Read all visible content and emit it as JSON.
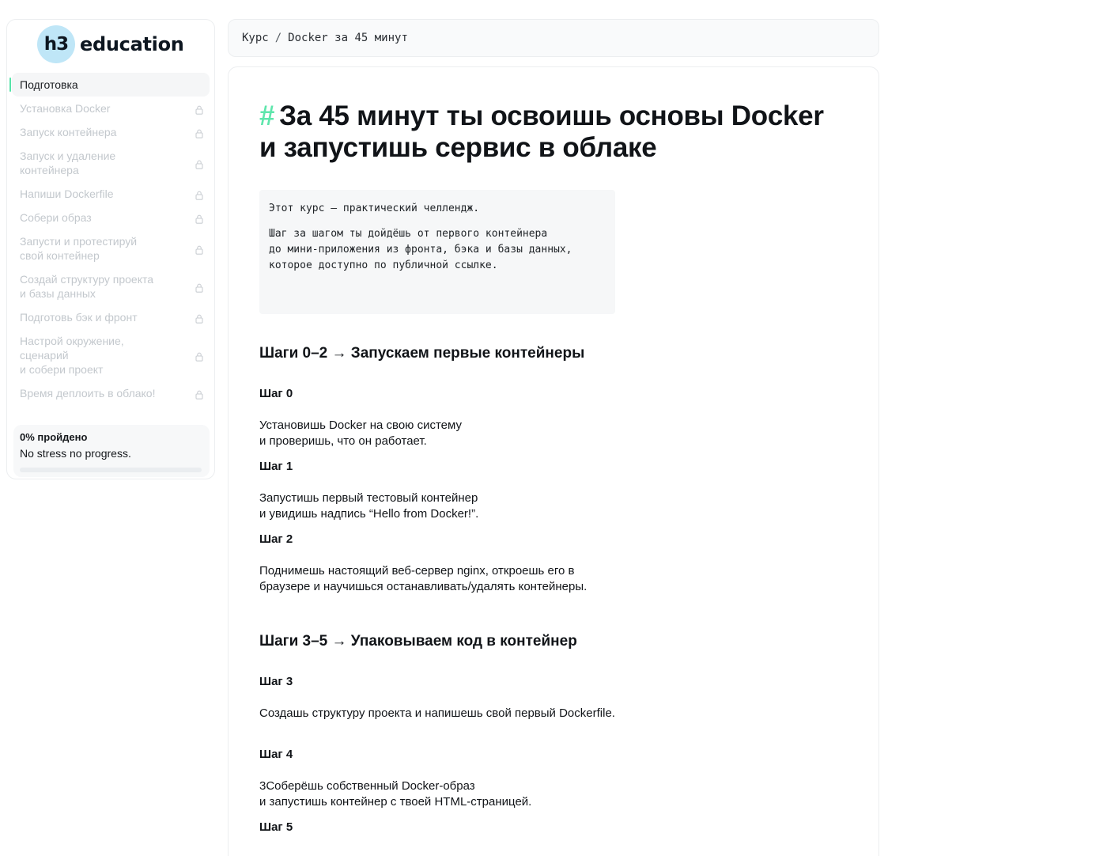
{
  "logo": {
    "badge": "h3",
    "word": "education"
  },
  "sidebar": {
    "items": [
      {
        "label": "Подготовка",
        "locked": false,
        "active": true
      },
      {
        "label": "Установка Docker",
        "locked": true
      },
      {
        "label": "Запуск контейнера",
        "locked": true
      },
      {
        "label": "Запуск и удаление\nконтейнера",
        "locked": true
      },
      {
        "label": "Напиши Dockerfile",
        "locked": true
      },
      {
        "label": "Собери образ",
        "locked": true
      },
      {
        "label": "Запусти и протестируй\nсвой контейнер",
        "locked": true
      },
      {
        "label": "Создай структуру проекта\nи базы данных",
        "locked": true
      },
      {
        "label": "Подготовь бэк и фронт",
        "locked": true
      },
      {
        "label": "Настрой окружение,\nсценарий\nи собери проект",
        "locked": true
      },
      {
        "label": "Время деплоить в облако!",
        "locked": true
      }
    ],
    "progress": {
      "title": "0% пройдено",
      "subtitle": "No stress no progress.",
      "fraction": 0
    }
  },
  "breadcrumb": {
    "root": "Курс",
    "separator": "/",
    "current": "Docker за 45 минут"
  },
  "main": {
    "title_hash": "#",
    "title": "За 45 минут ты освоишь основы Docker и запустишь сервис в облаке",
    "intro": [
      "Этот курс — практический челлендж.",
      "Шаг за шагом ты дойдёшь от первого контейнера\nдо мини-приложения из фронта, бэка и базы данных, которое доступно по публичной ссылке."
    ],
    "section1": "Шаги 0–2 → Запускаем первые контейнеры",
    "section2": "Шаги 3–5 → Упаковываем код в контейнер",
    "steps": [
      {
        "title": "Шаг 0",
        "text": "Установишь Docker на свою систему\nи проверишь, что он работает."
      },
      {
        "title": "Шаг 1",
        "text": "Запустишь первый тестовый контейнер\nи увидишь надпись “Hello from Docker!”."
      },
      {
        "title": "Шаг 2",
        "text": "Поднимешь настоящий веб-сервер nginx, откроешь его в браузере и научишься останавливать/удалять контейнеры."
      },
      {
        "title": "Шаг 3",
        "text": "Создашь структуру проекта и напишешь свой первый Dockerfile."
      },
      {
        "title": "Шаг 4",
        "text": "3Соберёшь собственный Docker-образ\nи запустишь контейнер с твоей HTML-страницей."
      },
      {
        "title": "Шаг 5",
        "text": ""
      }
    ]
  }
}
